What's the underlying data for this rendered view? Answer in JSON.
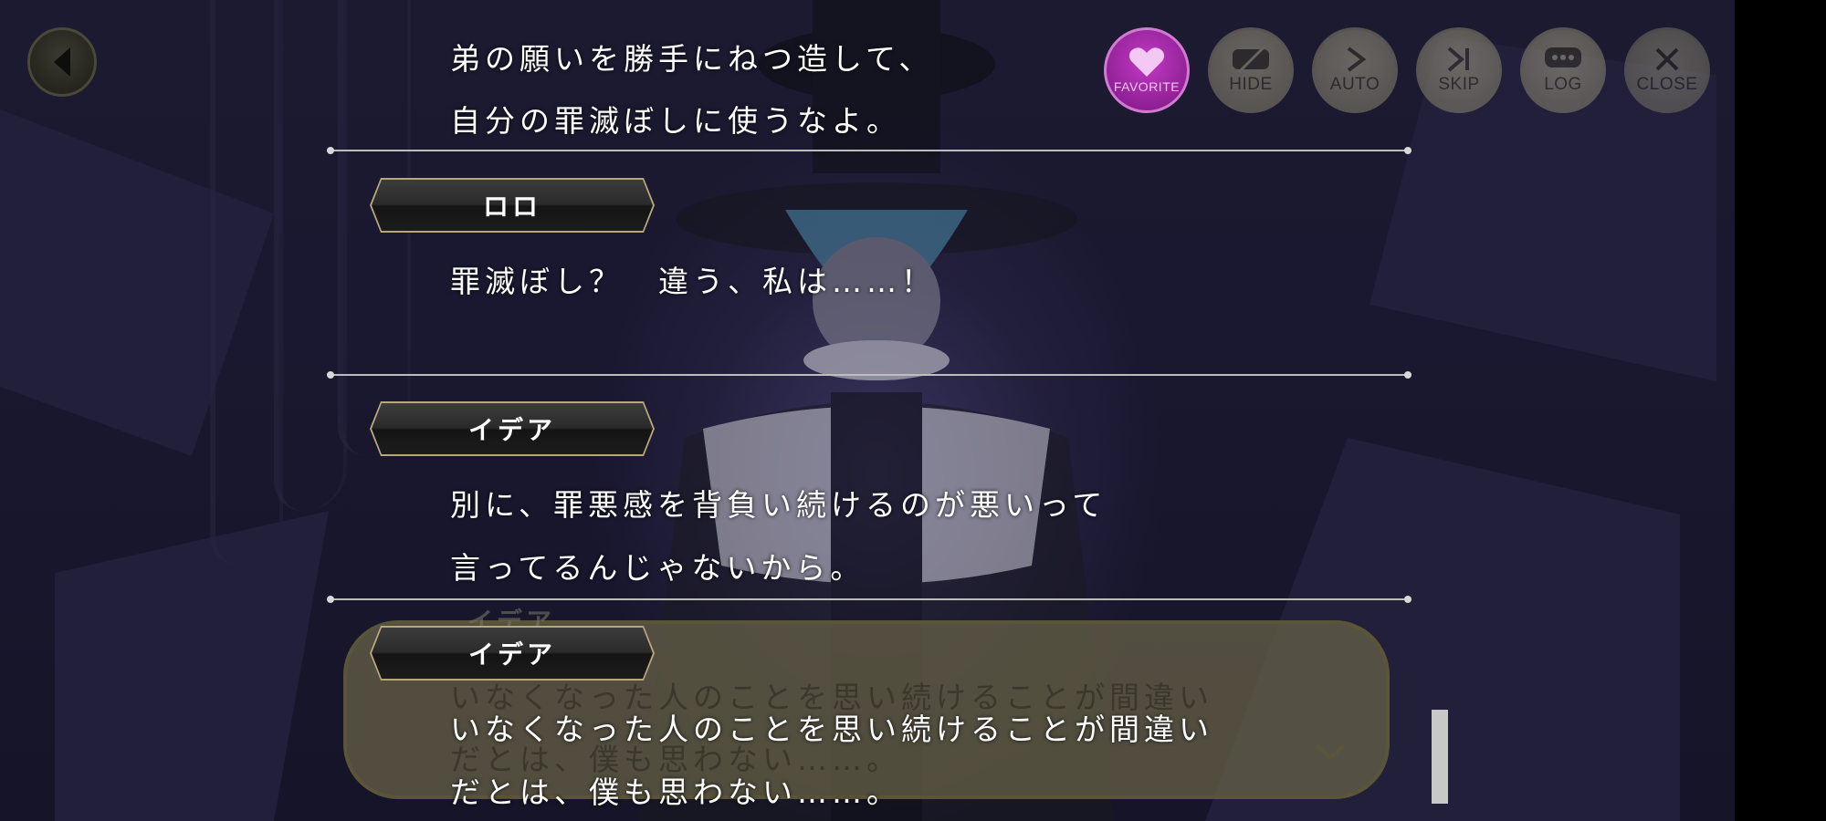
{
  "controls": {
    "favorite": "FAVORITE",
    "hide": "HIDE",
    "auto": "AUTO",
    "skip": "SKIP",
    "log": "LOG",
    "close": "CLOSE"
  },
  "log": [
    {
      "speaker": "",
      "lines": [
        "弟の願いを勝手にねつ造して、",
        "自分の罪滅ぼしに使うなよ。"
      ]
    },
    {
      "speaker": "ロロ",
      "lines": [
        "罪滅ぼし？　違う、私は……！"
      ]
    },
    {
      "speaker": "イデア",
      "lines": [
        "別に、罪悪感を背負い続けるのが悪いって",
        "言ってるんじゃないから。"
      ]
    },
    {
      "speaker": "イデア",
      "lines": [
        "いなくなった人のことを思い続けることが間違い",
        "だとは、僕も思わない……。"
      ]
    }
  ],
  "background_dialogue": {
    "speaker": "イデア",
    "lines": [
      "いなくなった人のことを思い続けることが間違い",
      "だとは、僕も思わない……。"
    ]
  },
  "colors": {
    "favorite": "#b22fb5",
    "plate_border": "#b8a77a",
    "separator": "#bdbdbd"
  }
}
